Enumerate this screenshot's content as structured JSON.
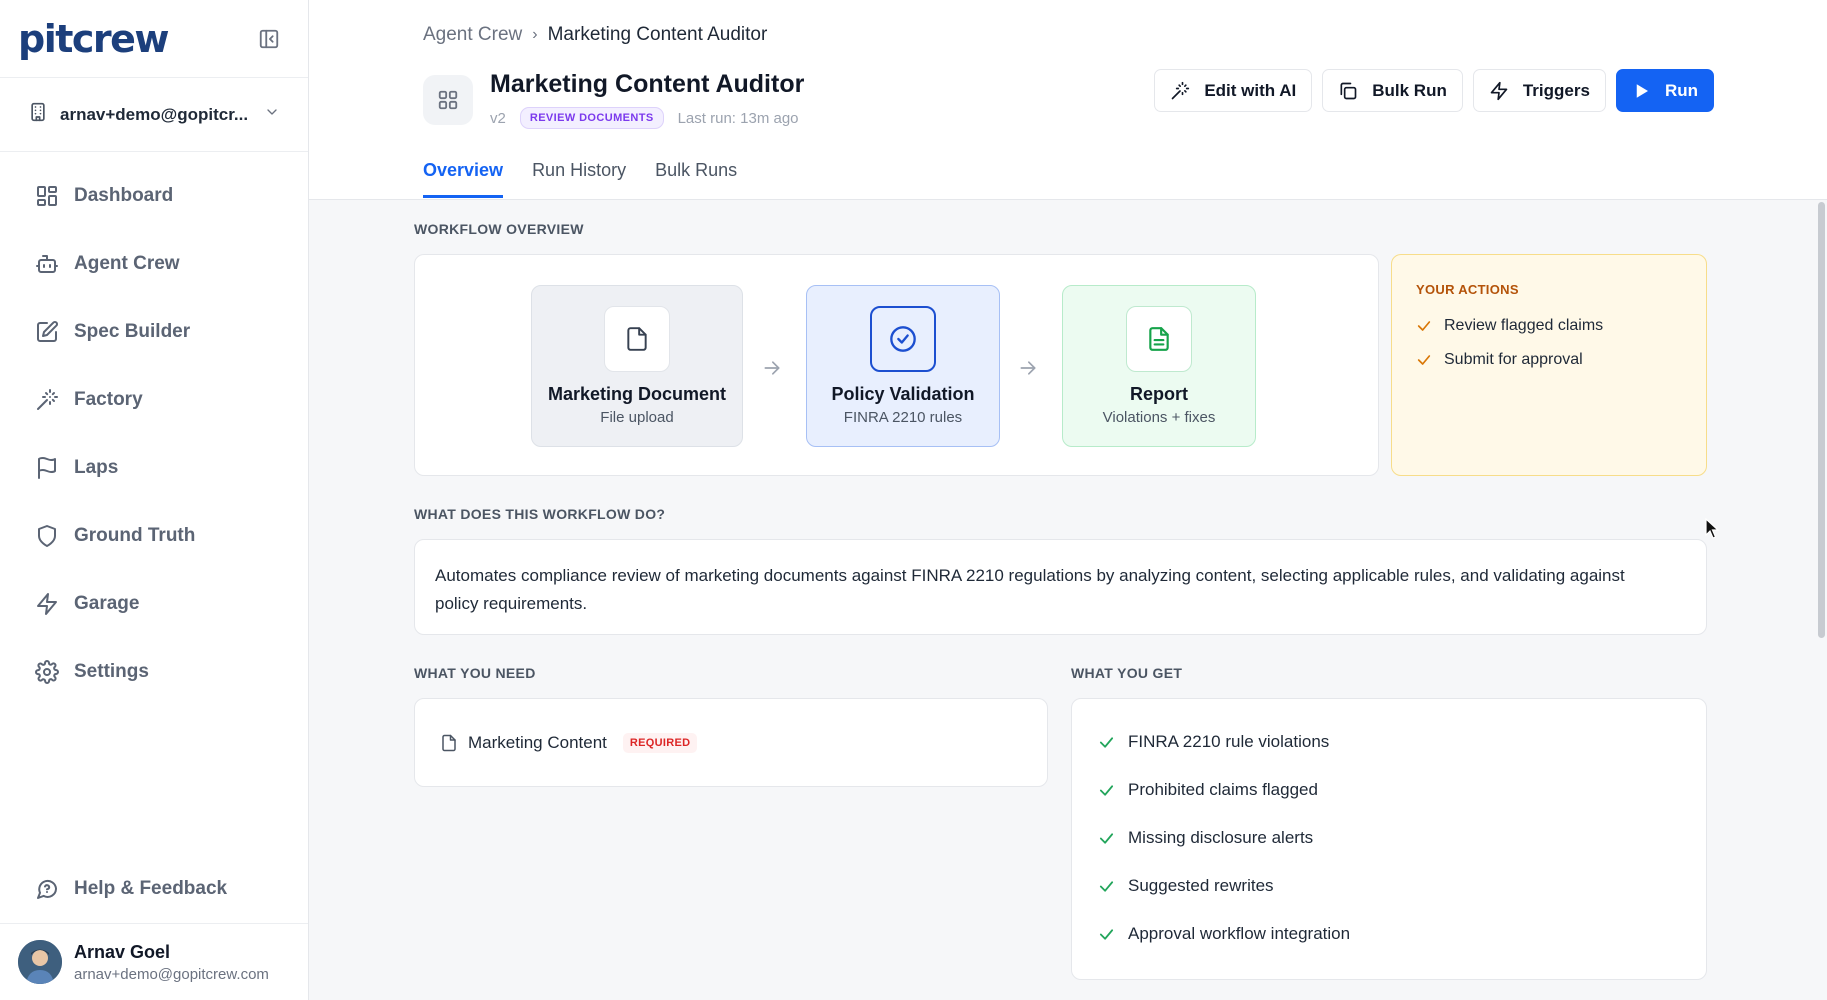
{
  "sidebar": {
    "logo": "pitcrew",
    "workspace": "arnav+demo@gopitcr...",
    "items": [
      {
        "label": "Dashboard",
        "icon": "dashboard-icon"
      },
      {
        "label": "Agent Crew",
        "icon": "bot-icon"
      },
      {
        "label": "Spec Builder",
        "icon": "edit-icon"
      },
      {
        "label": "Factory",
        "icon": "wand-icon"
      },
      {
        "label": "Laps",
        "icon": "flag-icon"
      },
      {
        "label": "Ground Truth",
        "icon": "shield-icon"
      },
      {
        "label": "Garage",
        "icon": "bolt-icon"
      },
      {
        "label": "Settings",
        "icon": "gear-icon"
      }
    ],
    "help": "Help & Feedback",
    "user": {
      "name": "Arnav Goel",
      "email": "arnav+demo@gopitcrew.com"
    }
  },
  "breadcrumb": {
    "parent": "Agent Crew",
    "separator": "›",
    "current": "Marketing Content Auditor"
  },
  "header": {
    "title": "Marketing Content Auditor",
    "version": "v2",
    "badge": "REVIEW DOCUMENTS",
    "last_run": "Last run: 13m ago",
    "buttons": {
      "edit_ai": "Edit with AI",
      "bulk_run": "Bulk Run",
      "triggers": "Triggers",
      "run": "Run"
    }
  },
  "tabs": [
    {
      "label": "Overview",
      "active": true
    },
    {
      "label": "Run History",
      "active": false
    },
    {
      "label": "Bulk Runs",
      "active": false
    }
  ],
  "overview": {
    "section_title": "WORKFLOW OVERVIEW",
    "nodes": [
      {
        "title": "Marketing Document",
        "subtitle": "File upload"
      },
      {
        "title": "Policy Validation",
        "subtitle": "FINRA 2210 rules"
      },
      {
        "title": "Report",
        "subtitle": "Violations + fixes"
      }
    ],
    "your_actions": {
      "title": "YOUR ACTIONS",
      "items": [
        "Review flagged claims",
        "Submit for approval"
      ]
    }
  },
  "description": {
    "title": "WHAT DOES THIS WORKFLOW DO?",
    "text": "Automates compliance review of marketing documents against FINRA 2210 regulations by analyzing content, selecting applicable rules, and validating against policy requirements."
  },
  "need": {
    "title": "WHAT YOU NEED",
    "items": [
      {
        "label": "Marketing Content",
        "badge": "REQUIRED"
      }
    ]
  },
  "get": {
    "title": "WHAT YOU GET",
    "items": [
      "FINRA 2210 rule violations",
      "Prohibited claims flagged",
      "Missing disclosure alerts",
      "Suggested rewrites",
      "Approval workflow integration"
    ]
  },
  "colors": {
    "accent": "#1463f3",
    "brand": "#1c3f7c",
    "success": "#22a55b",
    "warning_bg": "#fff9e8",
    "badge_purple": "#7c3aed",
    "required_red": "#dc2626"
  }
}
